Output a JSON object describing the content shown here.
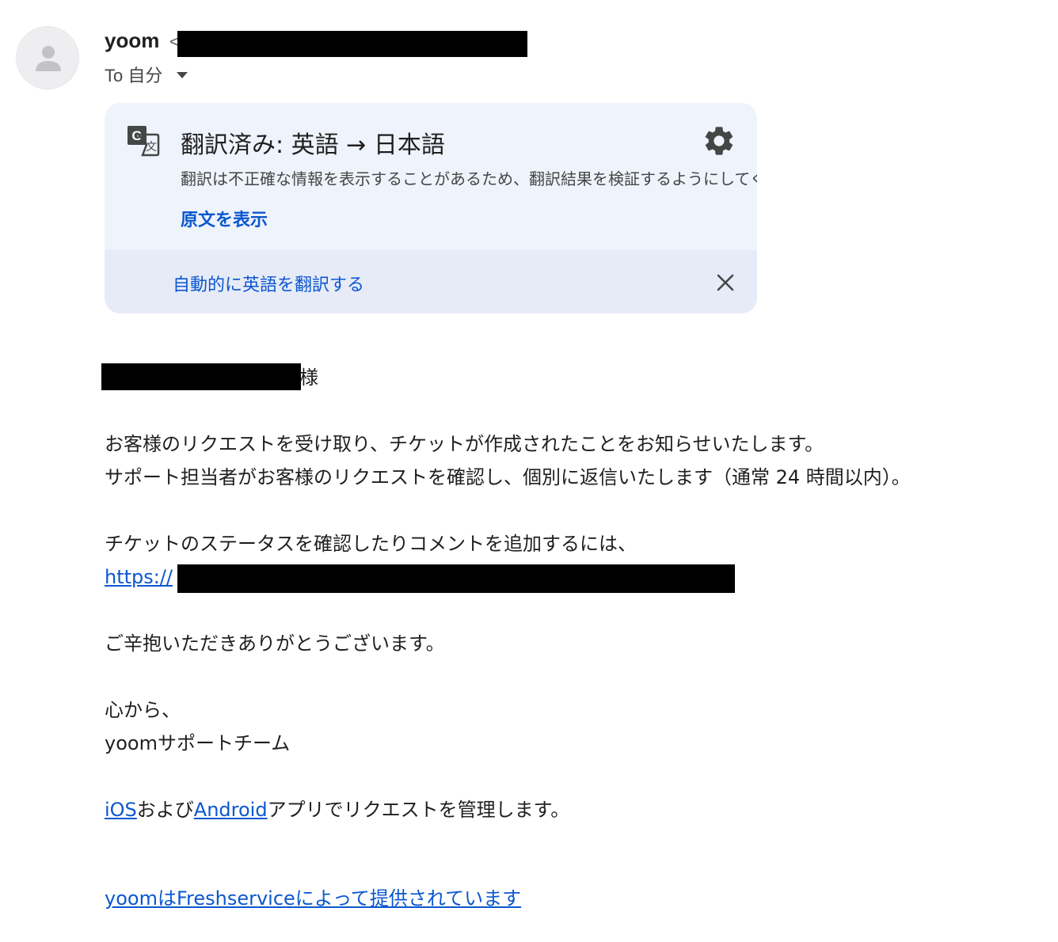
{
  "header": {
    "sender_name": "yoom",
    "sender_email_open": "<",
    "to_label": "To 自分"
  },
  "translation": {
    "title": "翻訳済み: 英語 → 日本語",
    "notice": "翻訳は不正確な情報を表示することがあるため、翻訳結果を検証するようにしてください",
    "show_original": "原文を表示",
    "auto_translate": "自動的に英語を翻訳する"
  },
  "message": {
    "greeting_suffix": "様",
    "line1": "お客様のリクエストを受け取り、チケットが作成されたことをお知らせいたします。",
    "line2": "サポート担当者がお客様のリクエストを確認し、個別に返信いたします（通常 24 時間以内）。",
    "line3": "チケットのステータスを確認したりコメントを追加するには、",
    "link_prefix": "https://",
    "thanks": "ご辛抱いただきありがとうございます。",
    "closing": "心から、",
    "signature": "yoomサポートチーム",
    "apps_ios": "iOS",
    "apps_and": "および",
    "apps_android": "Android",
    "apps_tail": "アプリでリクエストを管理します。",
    "powered_by": "yoomはFreshserviceによって提供されています"
  },
  "icons": [
    "avatar-person-icon",
    "google-translate-icon",
    "gear-icon",
    "close-icon",
    "chevron-down-icon"
  ],
  "colors": {
    "link": "#0b57d0",
    "card_bg": "#eff3fb",
    "card_footer_bg": "#e7ebf7"
  }
}
